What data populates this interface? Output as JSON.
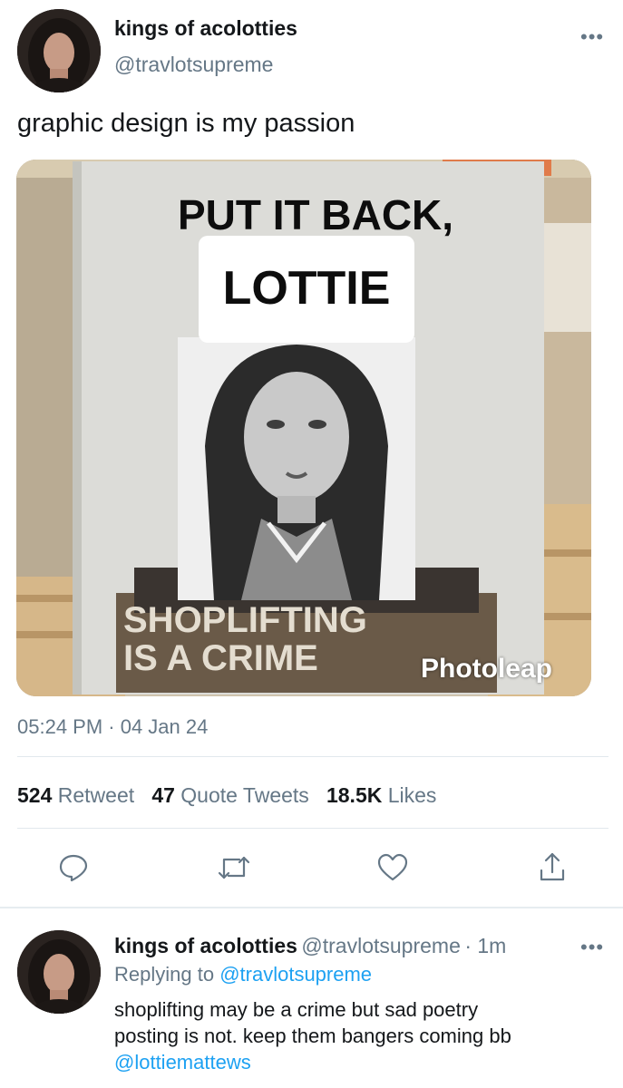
{
  "tweet": {
    "author_name": "kings of acolotties",
    "author_handle": "@travlotsupreme",
    "more_icon": "more-icon",
    "text": "graphic design is my passion",
    "media": {
      "sign_top": "PUT IT BACK,",
      "sign_name": "LOTTIE",
      "sign_bottom_1": "SHOPLIFTING",
      "sign_bottom_2": "IS A CRIME",
      "watermark": "Photoleap"
    },
    "time": "05:24 PM · 04 Jan 24",
    "stats": {
      "retweets_count": "524",
      "retweets_label": "Retweet",
      "quotes_count": "47",
      "quotes_label": "Quote Tweets",
      "likes_count": "18.5K",
      "likes_label": "Likes"
    },
    "actions": [
      "reply-icon",
      "retweet-icon",
      "like-icon",
      "share-icon"
    ]
  },
  "reply": {
    "author_name": "kings of acolotties",
    "author_handle": "@travlotsupreme",
    "time": "· 1m",
    "replying_prefix": "Replying to",
    "replying_handle": "@travlotsupreme",
    "text_line1": "shoplifting may be a crime but sad poetry",
    "text_line2": "posting is not. keep them bangers coming bb",
    "mention": "@lottiemattews"
  },
  "colors": {
    "link": "#1da1f2",
    "secondary": "#657786",
    "primary": "#14171a"
  }
}
